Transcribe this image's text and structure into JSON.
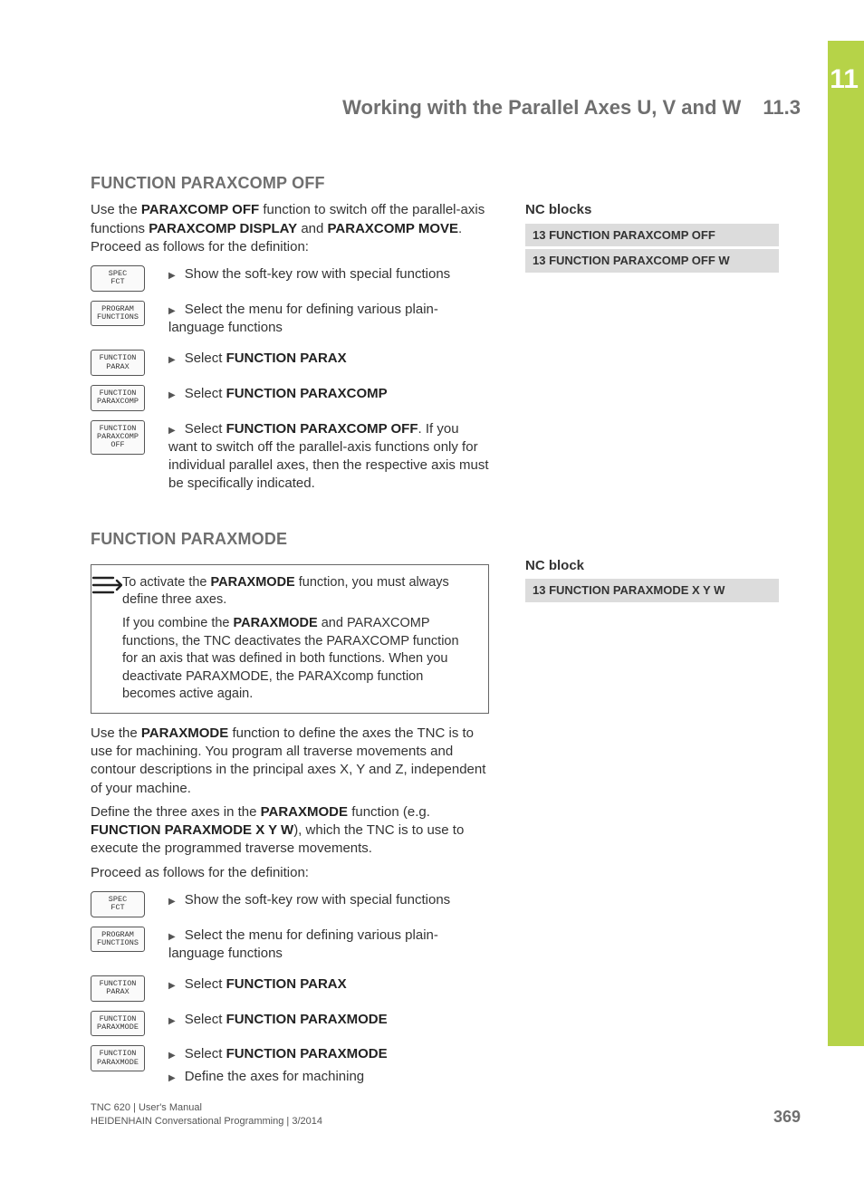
{
  "chapterNumber": "11",
  "runningHead": {
    "title": "Working with the Parallel Axes U, V and W",
    "section": "11.3"
  },
  "sec1": {
    "heading": "FUNCTION PARAXCOMP OFF",
    "introHtml": "Use the <b>PARAXCOMP OFF</b> function to switch off the parallel-axis functions <b>PARAXCOMP DISPLAY</b> and <b>PARAXCOMP MOVE</b>. Proceed as follows for the definition:",
    "steps": [
      {
        "key": "SPEC\nFCT",
        "keyType": "hardkey",
        "bullets": [
          {
            "html": "Show the soft-key row with special functions"
          }
        ]
      },
      {
        "key": "PROGRAM\nFUNCTIONS",
        "keyType": "softkey",
        "bullets": [
          {
            "html": "Select the menu for defining various plain-language functions"
          }
        ]
      },
      {
        "key": "FUNCTION\nPARAX",
        "keyType": "softkey",
        "bullets": [
          {
            "html": "Select <b>FUNCTION PARAX</b>"
          }
        ]
      },
      {
        "key": "FUNCTION\nPARAXCOMP",
        "keyType": "softkey",
        "bullets": [
          {
            "html": "Select <b>FUNCTION PARAXCOMP</b>"
          }
        ]
      },
      {
        "key": "FUNCTION\nPARAXCOMP\nOFF",
        "keyType": "softkey",
        "bullets": [
          {
            "html": "Select <b>FUNCTION PARAXCOMP OFF</b>. If you want to switch off the parallel-axis functions only for individual parallel axes, then the respective axis must be specifically indicated."
          }
        ]
      }
    ],
    "ncHead": "NC blocks",
    "ncLines": [
      "13 FUNCTION PARAXCOMP OFF",
      "13 FUNCTION PARAXCOMP OFF W"
    ]
  },
  "sec2": {
    "heading": "FUNCTION PARAXMODE",
    "note": {
      "para1Html": "To activate the <b>PARAXMODE</b> function, you must always define three axes.",
      "para2Html": "If you combine the <b>PARAXMODE</b> and PARAXCOMP functions, the TNC deactivates the PARAXCOMP function for an axis that was defined in both functions. When you deactivate PARAXMODE, the PARAXcomp function becomes active again."
    },
    "ncHead": "NC block",
    "ncLines": [
      "13 FUNCTION PARAXMODE X Y W"
    ],
    "body1Html": "Use the <b>PARAXMODE</b> function to define the axes the TNC is to use for machining. You program all traverse movements and contour descriptions in the principal axes X, Y and Z, independent of your machine.",
    "body2Html": "Define the three axes in the <b>PARAXMODE</b> function (e.g. <b>FUNCTION PARAXMODE X Y W</b>), which the TNC is to use to execute the programmed traverse movements.",
    "body3": "Proceed as follows for the definition:",
    "steps": [
      {
        "key": "SPEC\nFCT",
        "keyType": "hardkey",
        "bullets": [
          {
            "html": "Show the soft-key row with special functions"
          }
        ]
      },
      {
        "key": "PROGRAM\nFUNCTIONS",
        "keyType": "softkey",
        "bullets": [
          {
            "html": "Select the menu for defining various plain-language functions"
          }
        ]
      },
      {
        "key": "FUNCTION\nPARAX",
        "keyType": "softkey",
        "bullets": [
          {
            "html": "Select <b>FUNCTION PARAX</b>"
          }
        ]
      },
      {
        "key": "FUNCTION\nPARAXMODE",
        "keyType": "softkey",
        "bullets": [
          {
            "html": "Select <b>FUNCTION PARAXMODE</b>"
          }
        ]
      },
      {
        "key": "FUNCTION\nPARAXMODE",
        "keyType": "softkey",
        "bullets": [
          {
            "html": "Select <b>FUNCTION PARAXMODE</b>"
          },
          {
            "html": "Define the axes for machining"
          }
        ]
      }
    ]
  },
  "footer": {
    "line1": "TNC 620 | User's Manual",
    "line2": "HEIDENHAIN Conversational Programming | 3/2014"
  },
  "pageNumber": "369"
}
